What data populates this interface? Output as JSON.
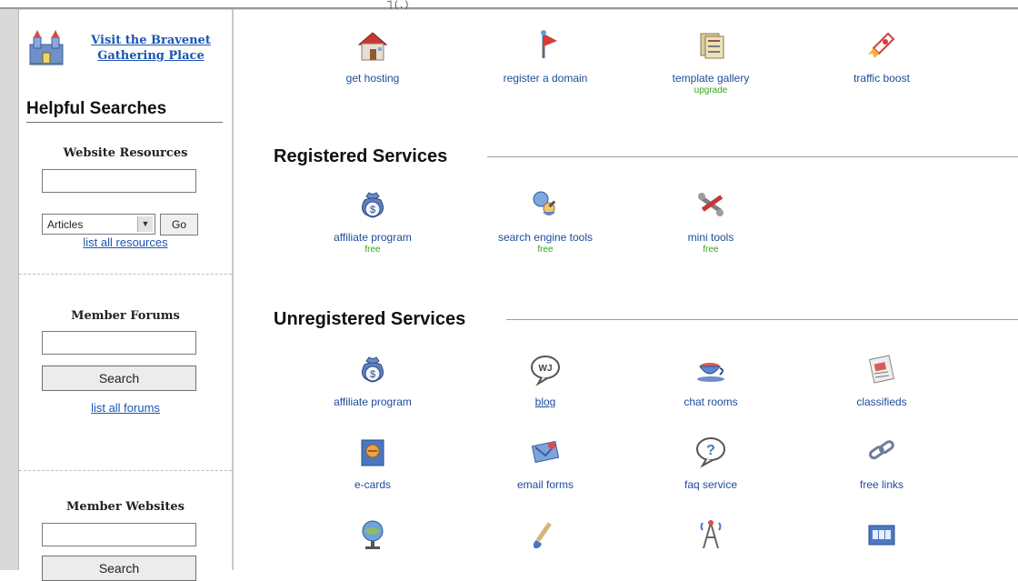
{
  "top_fragment": "̃ | ( , )",
  "sidebar": {
    "gathering_link": [
      "Visit the Bravenet",
      "Gathering Place"
    ],
    "helpful_searches": "Helpful Searches",
    "resources": {
      "title": "Website Resources",
      "input_value": "",
      "select_value": "Articles",
      "go_label": "Go",
      "link": "list all resources"
    },
    "forums": {
      "title": "Member Forums",
      "input_value": "",
      "search_label": "Search",
      "link": "list all forums"
    },
    "websites": {
      "title": "Member Websites",
      "input_value": "",
      "search_label": "Search"
    }
  },
  "main": {
    "top_services": [
      {
        "label": "get hosting",
        "sub": "",
        "icon": "house-icon"
      },
      {
        "label": "register a domain",
        "sub": "",
        "icon": "flag-pin-icon"
      },
      {
        "label": "template gallery",
        "sub": "upgrade",
        "icon": "template-icon"
      },
      {
        "label": "traffic boost",
        "sub": "",
        "icon": "rocket-icon"
      }
    ],
    "registered": {
      "title": "Registered Services",
      "items": [
        {
          "label": "affiliate program",
          "sub": "free",
          "icon": "money-bag-icon"
        },
        {
          "label": "search engine tools",
          "sub": "free",
          "icon": "search-person-icon"
        },
        {
          "label": "mini tools",
          "sub": "free",
          "icon": "tools-icon"
        }
      ]
    },
    "unregistered": {
      "title": "Unregistered Services",
      "items": [
        {
          "label": "affiliate program",
          "icon": "money-bag-icon"
        },
        {
          "label": "blog",
          "icon": "blog-bubble-icon"
        },
        {
          "label": "chat rooms",
          "icon": "coffee-cup-icon"
        },
        {
          "label": "classifieds",
          "icon": "newspaper-icon"
        },
        {
          "label": "e-cards",
          "icon": "ecard-icon"
        },
        {
          "label": "email forms",
          "icon": "envelope-icon"
        },
        {
          "label": "faq service",
          "icon": "faq-bubble-icon"
        },
        {
          "label": "free links",
          "icon": "chain-link-icon"
        },
        {
          "label": "",
          "icon": "globe-icon"
        },
        {
          "label": "",
          "icon": "brush-icon"
        },
        {
          "label": "",
          "icon": "radio-tower-icon"
        },
        {
          "label": "",
          "icon": "counter-icon"
        }
      ]
    }
  },
  "colors": {
    "link": "#1b56b2",
    "label": "#1e4b9b",
    "free": "#35a51c"
  }
}
